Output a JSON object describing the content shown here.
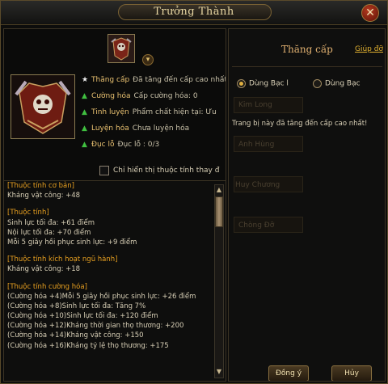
{
  "window": {
    "title": "Trưởng Thành",
    "close_label": "✕"
  },
  "item": {
    "stats": [
      {
        "icon": "star-icon",
        "label": "Thăng cấp",
        "value": "Đã tăng đến cấp cao nhất"
      },
      {
        "icon": "green-arrow-icon",
        "label": "Cường hóa",
        "value": "Cấp cường hóa: 0"
      },
      {
        "icon": "green-arrow-icon",
        "label": "Tinh luyện",
        "value": "Phẩm chất hiện tại: Ưu"
      },
      {
        "icon": "green-arrow-icon",
        "label": "Luyện hóa",
        "value": "Chưa luyện hóa"
      },
      {
        "icon": "green-arrow-icon",
        "label": "Đục lỗ",
        "value": "Đục lỗ : 0/3"
      }
    ],
    "checkbox_label": "Chỉ hiển thị thuộc tính thay đ",
    "checkbox_checked": false
  },
  "attributes": [
    {
      "type": "head",
      "text": "[Thuộc tính cơ bản]"
    },
    {
      "type": "line",
      "text": "Kháng vật công: +48"
    },
    {
      "type": "blank",
      "text": ""
    },
    {
      "type": "head",
      "text": "[Thuộc tính]"
    },
    {
      "type": "line",
      "text": "Sinh lực tối đa: +61 điểm"
    },
    {
      "type": "line",
      "text": "Nội lực tối đa: +70 điểm"
    },
    {
      "type": "line",
      "text": "Mỗi 5 giây hồi phục sinh lực: +9 điểm"
    },
    {
      "type": "blank",
      "text": ""
    },
    {
      "type": "head",
      "text": "[Thuộc tính kích hoạt ngũ hành]"
    },
    {
      "type": "line",
      "text": "Kháng vật công: +18"
    },
    {
      "type": "blank",
      "text": ""
    },
    {
      "type": "head",
      "text": "[Thuộc tính cường hóa]"
    },
    {
      "type": "line",
      "text": "(Cường hóa +4)Mỗi 5 giây hồi phục sinh lực: +26 điểm"
    },
    {
      "type": "line",
      "text": "(Cường hóa +8)Sinh lực tối đa: Tăng 7%"
    },
    {
      "type": "line",
      "text": "(Cường hóa +10)Sinh lực tối đa: +120 điểm"
    },
    {
      "type": "line",
      "text": "(Cường hóa +12)Kháng thời gian thọ thương: +200"
    },
    {
      "type": "line",
      "text": "(Cường hóa +14)Kháng vật công: +150"
    },
    {
      "type": "line",
      "text": "(Cường hóa +16)Kháng tỷ lệ thọ thương: +175"
    }
  ],
  "upgrade_panel": {
    "title": "Thăng cấp",
    "help_link": "Giúp đỡ",
    "radio_options": [
      {
        "label": "Dùng Bạc l",
        "selected": true
      },
      {
        "label": "Dùng Bạc",
        "selected": false
      }
    ],
    "ghost_buttons": [
      "Kim Long",
      "Anh Hùng",
      "Huy Chương",
      "Chòng Đỡ"
    ],
    "message": "Trang bị này đã tăng đến cấp cao nhất!"
  },
  "buttons": {
    "confirm": "Đồng ý",
    "cancel": "Hủy"
  }
}
